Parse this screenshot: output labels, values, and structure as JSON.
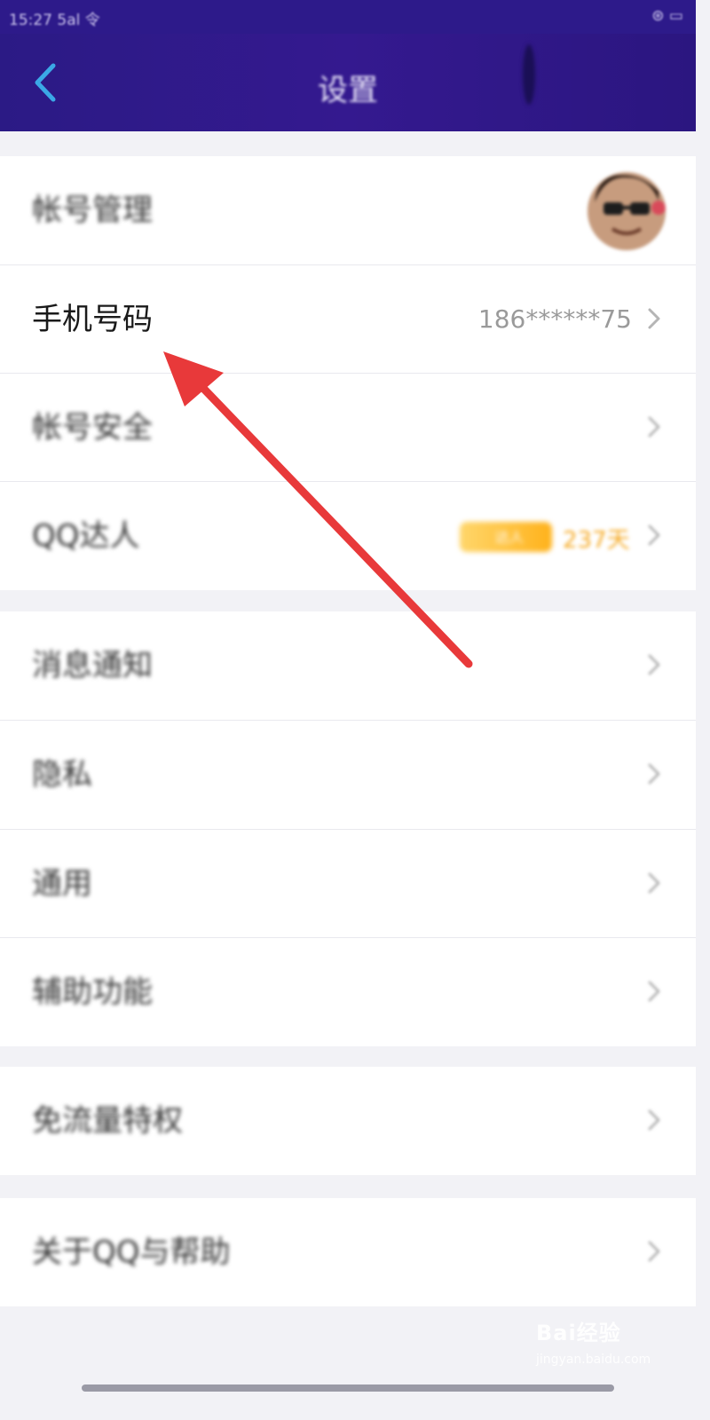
{
  "status": {
    "time": "15:27 5al 令",
    "right": "⊛ ▭"
  },
  "nav": {
    "title": "设置",
    "back_icon": "back-chevron-icon"
  },
  "sections": [
    {
      "items": [
        {
          "label": "帐号管理",
          "right": "avatar"
        },
        {
          "label": "手机号码",
          "value": "186******75"
        },
        {
          "label": "帐号安全"
        },
        {
          "label": "QQ达人",
          "badge": "达人",
          "value": "237天"
        }
      ]
    },
    {
      "items": [
        {
          "label": "消息通知"
        },
        {
          "label": "隐私"
        },
        {
          "label": "通用"
        },
        {
          "label": "辅助功能"
        }
      ]
    },
    {
      "items": [
        {
          "label": "免流量特权"
        }
      ]
    },
    {
      "items": [
        {
          "label": "关于QQ与帮助"
        }
      ]
    }
  ],
  "annotation": {
    "type": "arrow",
    "color": "#e8393a",
    "target": "手机号码"
  },
  "watermark": {
    "brand": "Bai经验",
    "url": "jingyan.baidu.com"
  },
  "colors": {
    "nav_bg": "#2d1a8a",
    "page_bg": "#f2f2f6",
    "row_bg": "#ffffff",
    "accent_orange": "#f5a820"
  }
}
